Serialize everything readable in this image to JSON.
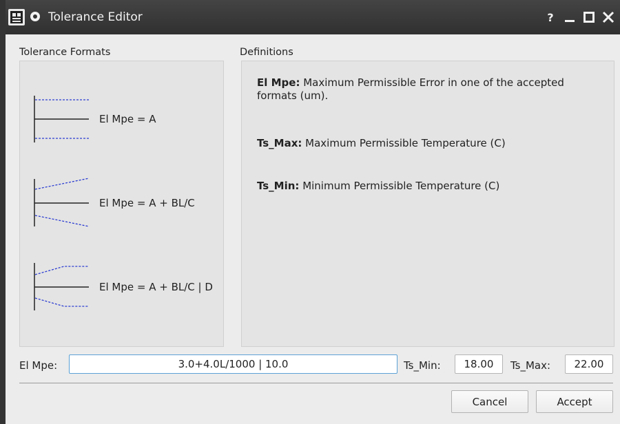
{
  "window": {
    "title": "Tolerance Editor",
    "buttons": {
      "help": "?",
      "minimize": "_",
      "maximize": "□",
      "close": "X"
    }
  },
  "formats": {
    "label": "Tolerance Formats",
    "items": [
      {
        "formula": "El Mpe = A"
      },
      {
        "formula": "El Mpe = A + BL/C"
      },
      {
        "formula": "El Mpe = A + BL/C | D"
      }
    ]
  },
  "definitions": {
    "label": "Definitions",
    "items": [
      {
        "term": "El Mpe:",
        "text": " Maximum Permissible Error in one of the accepted formats (um)."
      },
      {
        "term": "Ts_Max:",
        "text": " Maximum Permissible Temperature (C)"
      },
      {
        "term": "Ts_Min:",
        "text": " Minimum Permissible Temperature (C)"
      }
    ]
  },
  "inputs": {
    "el_mpe": {
      "label": "El Mpe:",
      "value": "3.0+4.0L/1000 | 10.0"
    },
    "ts_min": {
      "label": "Ts_Min:",
      "value": "18.00"
    },
    "ts_max": {
      "label": "Ts_Max:",
      "value": "22.00"
    }
  },
  "actions": {
    "cancel": "Cancel",
    "accept": "Accept"
  },
  "colors": {
    "dashed_line": "#2b3cd1",
    "focus_border": "#5aa0d6",
    "titlebar": "#343434"
  }
}
